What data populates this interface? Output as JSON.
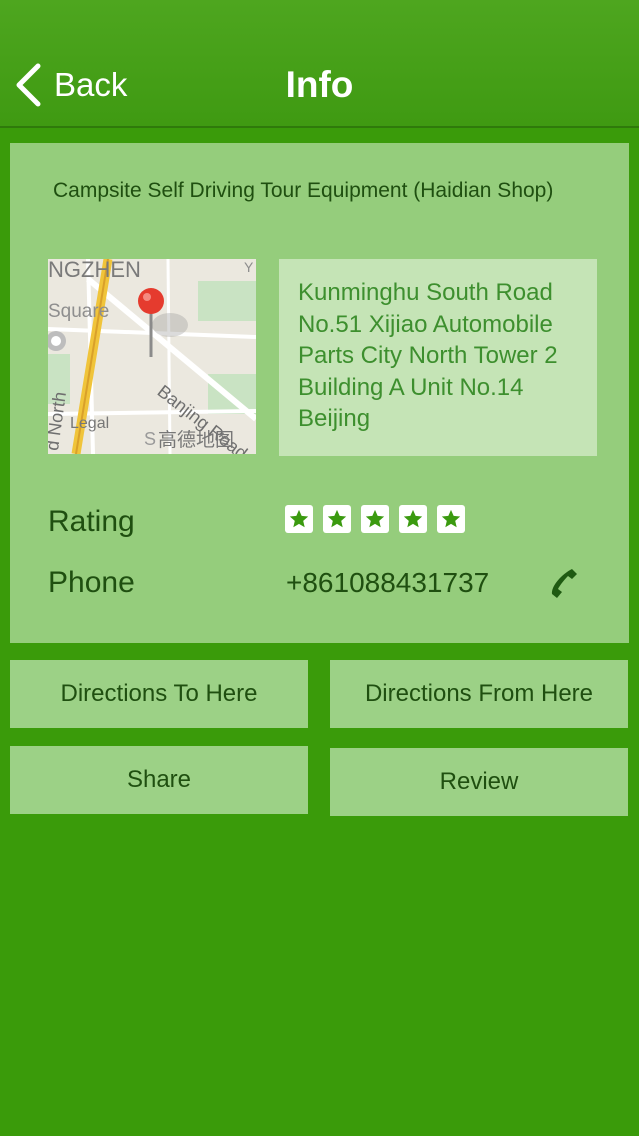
{
  "nav": {
    "back_label": "Back",
    "title": "Info"
  },
  "place": {
    "name": "Campsite Self Driving Tour Equipment (Haidian Shop)",
    "address": "Kunminghu South Road No.51 Xijiao Automobile Parts City North Tower 2 Building A Unit No.14 Beijing"
  },
  "map": {
    "labels": {
      "district": "NGZHEN",
      "square": "Square",
      "road": "Banjing Road",
      "north": "d North",
      "legal": "Legal",
      "provider": "高德地图",
      "s": "S",
      "y": "Y"
    }
  },
  "rating": {
    "label": "Rating",
    "stars": 5
  },
  "phone": {
    "label": "Phone",
    "number": "+861088431737"
  },
  "buttons": {
    "directions_to": "Directions To Here",
    "directions_from": "Directions From Here",
    "share": "Share",
    "review": "Review"
  },
  "colors": {
    "background": "#3a9b0a",
    "card": "#95cd7c",
    "button": "#9cd186",
    "text": "#1f4f10"
  }
}
